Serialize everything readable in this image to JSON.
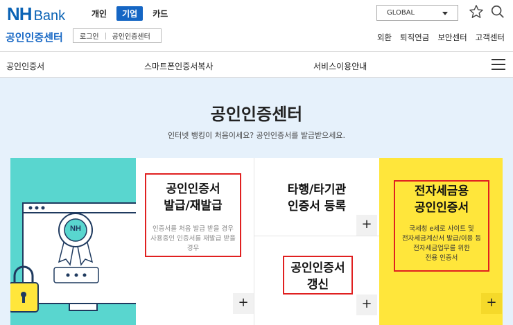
{
  "brand": {
    "nh": "NH",
    "bank": "Bank"
  },
  "mode_tabs": [
    {
      "label": "개인",
      "active": false
    },
    {
      "label": "기업",
      "active": true
    },
    {
      "label": "카드",
      "active": false
    }
  ],
  "center_title": "공인인증센터",
  "login": {
    "login_label": "로그인",
    "cert_center_label": "공인인증센터"
  },
  "global_select": {
    "value": "GLOBAL"
  },
  "util_links": [
    "외환",
    "퇴직연금",
    "보안센터",
    "고객센터"
  ],
  "nav": {
    "items": [
      "공인인증서",
      "스마트폰인증서복사",
      "서비스이용안내"
    ]
  },
  "hero": {
    "title": "공인인증센터",
    "subtitle": "인터넷 뱅킹이 처음이세요? 공인인증서를 발급받으세요."
  },
  "illustration": {
    "badge_text": "NH"
  },
  "cards": {
    "issue": {
      "title_line1": "공인인증서",
      "title_line2": "발급/재발급",
      "desc_line1": "인증서를 처음 발급 받을 경우",
      "desc_line2": "사용중인 인증서를 재발급 받을",
      "desc_line3": "경우",
      "plus": "+"
    },
    "other": {
      "title_line1": "타행/타기관",
      "title_line2": "인증서 등록",
      "plus": "+"
    },
    "renew": {
      "title_line1": "공인인증서",
      "title_line2": "갱신",
      "plus": "+"
    },
    "tax": {
      "title_line1": "전자세금용",
      "title_line2": "공인인증서",
      "desc_line1": "국세청 e세로 사이트 및",
      "desc_line2": "전자세금계산서 발급/이용 등",
      "desc_line3": "전자세금업무를 위한",
      "desc_line4": "전용 인증서",
      "plus": "+"
    }
  },
  "colors": {
    "brand_blue": "#1566c4",
    "hero_bg": "#e6f1fb",
    "teal": "#59d6cf",
    "yellow": "#ffe63b",
    "highlight_red": "#e02020"
  },
  "icons": [
    "star-icon",
    "search-icon",
    "menu-icon",
    "chevron-down-icon",
    "lock-icon",
    "certificate-badge-icon"
  ]
}
